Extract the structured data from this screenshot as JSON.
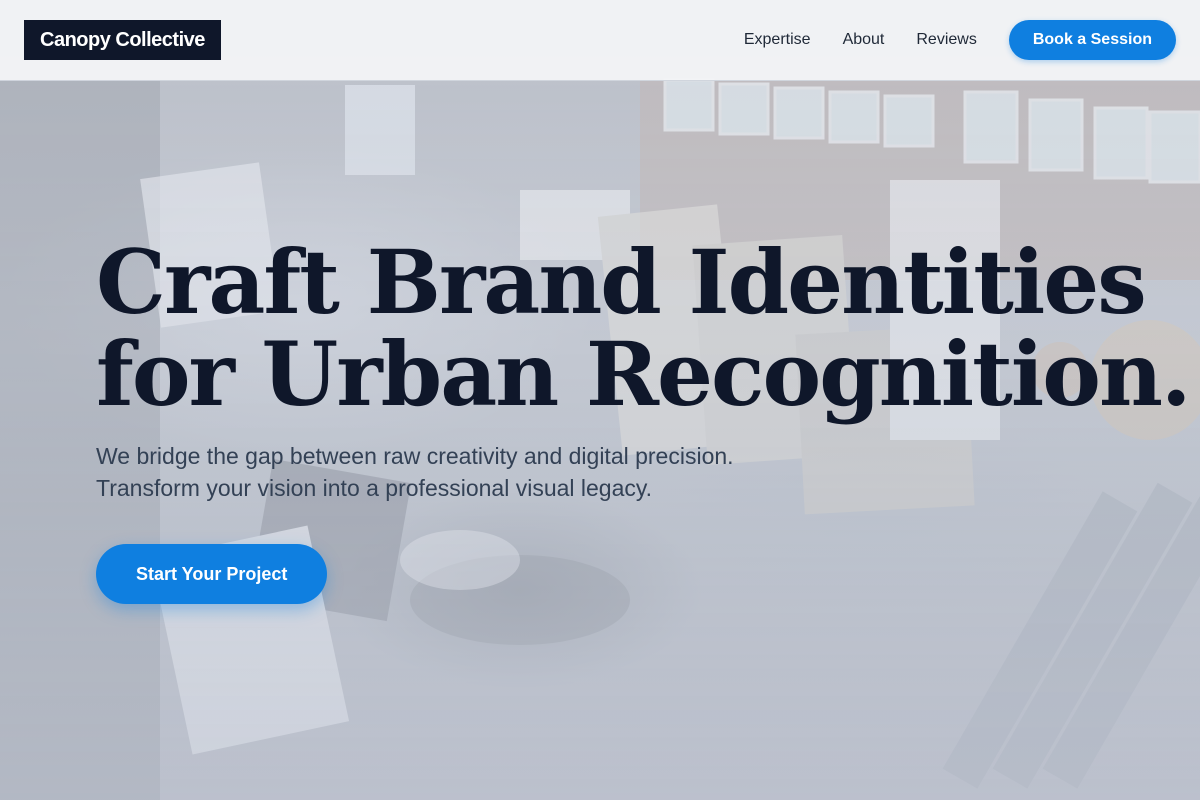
{
  "header": {
    "logo": "Canopy Collective",
    "nav": [
      {
        "label": "Expertise"
      },
      {
        "label": "About"
      },
      {
        "label": "Reviews"
      }
    ],
    "cta_label": "Book a Session"
  },
  "hero": {
    "title_line1": "Craft Brand Identities",
    "title_line2": "for Urban Recognition.",
    "subtitle": "We bridge the gap between raw creativity and digital precision. Transform your vision into a professional visual legacy.",
    "cta_label": "Start Your Project"
  },
  "colors": {
    "accent": "#0f7fe0",
    "dark": "#0f172a",
    "text": "#334155"
  }
}
